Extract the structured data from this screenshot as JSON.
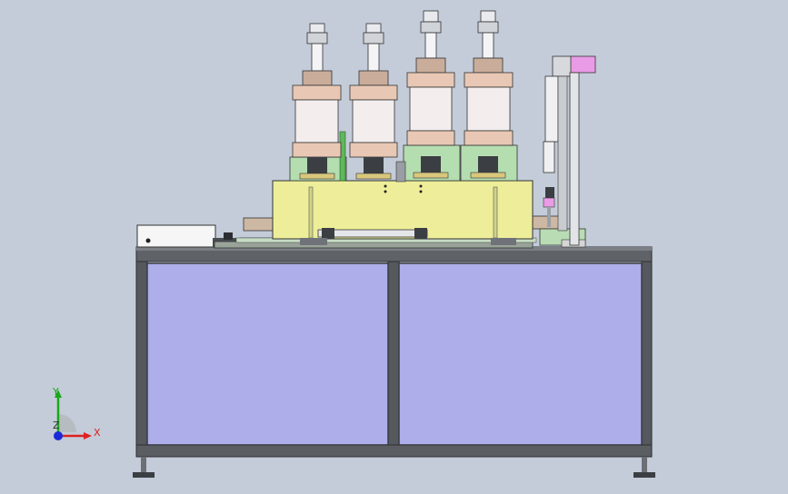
{
  "viewport": {
    "background": "#c3ccd8"
  },
  "model": {
    "colors": {
      "frame": "#5a5d62",
      "panel": "#adaeea",
      "plate": "#eeee9a",
      "cylinder": "#f5eeee",
      "green_part": "#aee0a8",
      "magenta_part": "#e99be6",
      "steel": "#d9dde2"
    },
    "cylinder_count": 4,
    "panel_count": 2
  },
  "triad": {
    "x_label": "X",
    "y_label": "Y",
    "z_label": "Z",
    "x_color": "#e02020",
    "y_color": "#1aa81a",
    "z_color": "#1a2ad8"
  }
}
